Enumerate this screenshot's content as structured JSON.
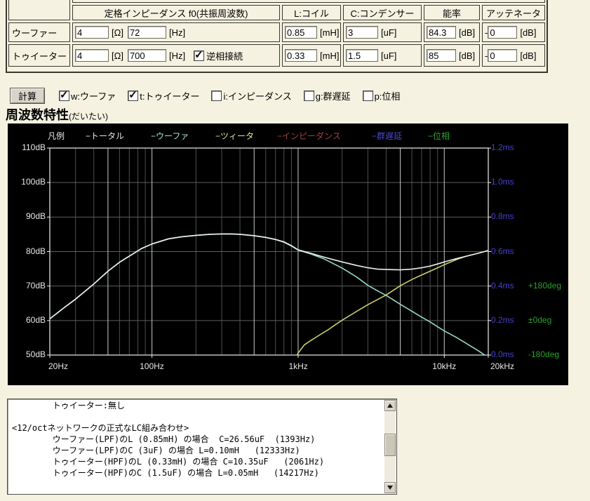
{
  "speaker_table": {
    "headers": {
      "spec": "定格インピーダンス f0(共振周波数)",
      "coil": "L:コイル",
      "cap": "C:コンデンサー",
      "efficiency": "能率",
      "attenuator": "アッテネータ"
    },
    "units": {
      "impedance": "[Ω]",
      "f0": "[Hz]",
      "coil": "[mH]",
      "cap": "[uF]",
      "db": "[dB]"
    },
    "rows": {
      "0": {
        "label": "ウーファー",
        "impedance": "4",
        "f0": "72",
        "coil": "0.85",
        "cap": "3",
        "efficiency": "84.3",
        "att_prefix": "-",
        "attenuator": "0"
      },
      "1": {
        "label": "トゥイーター",
        "impedance": "4",
        "f0": "700",
        "reverse_label": "逆相接続",
        "reverse_checked": true,
        "coil": "0.33",
        "cap": "1.5",
        "efficiency": "85",
        "att_prefix": "-",
        "attenuator": "0"
      }
    }
  },
  "controls": {
    "calc_button": "計算",
    "checkboxes": [
      {
        "id": "woofer",
        "label": "w:ウーファ",
        "checked": true
      },
      {
        "id": "tweeter",
        "label": "t:トゥイーター",
        "checked": true
      },
      {
        "id": "impedance",
        "label": "i:インピーダンス",
        "checked": false
      },
      {
        "id": "group-delay",
        "label": "g:群遅延",
        "checked": false
      },
      {
        "id": "phase",
        "label": "p:位相",
        "checked": false
      }
    ]
  },
  "heading": {
    "title": "周波数特性",
    "subtitle": "(だいたい)"
  },
  "chart_data": {
    "type": "line",
    "title": "周波数特性(だいたい)",
    "x_axis": {
      "scale": "log",
      "min": 20,
      "max": 20000,
      "ticks": [
        {
          "f": 20,
          "label": "20Hz",
          "align": "left"
        },
        {
          "f": 100,
          "label": "100Hz"
        },
        {
          "f": 1000,
          "label": "1kHz"
        },
        {
          "f": 10000,
          "label": "10kHz"
        },
        {
          "f": 20000,
          "label": "20kHz",
          "dx": 20
        }
      ]
    },
    "y_axis": {
      "min": 50,
      "max": 110,
      "ticks": [
        {
          "db": 110,
          "label": "110dB",
          "ms": "1.2ms"
        },
        {
          "db": 100,
          "label": "100dB",
          "ms": "1.0ms"
        },
        {
          "db": 90,
          "label": "90dB",
          "ms": "0.8ms"
        },
        {
          "db": 80,
          "label": "80dB",
          "ms": "0.6ms"
        },
        {
          "db": 70,
          "label": "70dB",
          "ms": "0.4ms",
          "deg": "+180deg"
        },
        {
          "db": 60,
          "label": "60dB",
          "ms": "0.2ms",
          "deg": "±0deg"
        },
        {
          "db": 50,
          "label": "50dB",
          "ms": "0.0ms",
          "deg": "-180deg"
        }
      ]
    },
    "grid": {
      "v_minor": [
        30,
        40,
        60,
        70,
        80,
        90,
        200,
        300,
        400,
        600,
        700,
        800,
        900,
        2000,
        3000,
        4000,
        6000,
        7000,
        8000,
        9000
      ],
      "v_major": [
        50,
        100,
        500,
        1000,
        5000,
        10000
      ],
      "h_lines": [
        100,
        90,
        80,
        70,
        60
      ],
      "minor_color": "#4f4f4f",
      "major_color": "#c8c8c8",
      "h_color": "#5e5e5e",
      "frame_color": "#efefef"
    },
    "legend": {
      "title": "凡例",
      "items": [
        {
          "label": "トータル",
          "color": "#e8e8e8"
        },
        {
          "label": "ウーファ",
          "color": "#a6e2d2"
        },
        {
          "label": "ツィータ",
          "color": "#e2e29e"
        },
        {
          "label": "インピーダンス",
          "color": "#a04444"
        },
        {
          "label": "群遅延",
          "color": "#4b4bd2"
        },
        {
          "label": "位相",
          "color": "#2fa32f"
        }
      ]
    },
    "series": [
      {
        "name": "ウーファ",
        "color": "#96d8c8",
        "points": [
          [
            20,
            60.5
          ],
          [
            25,
            63.7
          ],
          [
            30,
            66.2
          ],
          [
            40,
            70.6
          ],
          [
            50,
            74.3
          ],
          [
            60,
            76.9
          ],
          [
            72,
            79.0
          ],
          [
            85,
            80.9
          ],
          [
            100,
            82.2
          ],
          [
            130,
            83.7
          ],
          [
            160,
            84.3
          ],
          [
            200,
            84.7
          ],
          [
            250,
            85.0
          ],
          [
            300,
            85.1
          ],
          [
            350,
            85.1
          ],
          [
            400,
            85.0
          ],
          [
            500,
            84.6
          ],
          [
            600,
            84.1
          ],
          [
            700,
            83.5
          ],
          [
            800,
            82.7
          ],
          [
            900,
            81.6
          ],
          [
            1000,
            80.4
          ],
          [
            1200,
            79.4
          ],
          [
            1500,
            77.9
          ],
          [
            1800,
            76.2
          ],
          [
            2000,
            75.2
          ],
          [
            2500,
            72.7
          ],
          [
            3000,
            70.2
          ],
          [
            3500,
            68.6
          ],
          [
            4000,
            67.3
          ],
          [
            5000,
            64.7
          ],
          [
            6000,
            62.7
          ],
          [
            7000,
            61.0
          ],
          [
            8000,
            59.6
          ],
          [
            9000,
            58.2
          ],
          [
            10000,
            57.0
          ],
          [
            12000,
            55.2
          ],
          [
            14000,
            53.5
          ],
          [
            17000,
            51.3
          ],
          [
            20000,
            49.3
          ]
        ]
      },
      {
        "name": "ツィータ",
        "color": "#cdd06a",
        "points": [
          [
            940,
            48.5
          ],
          [
            1000,
            50.6
          ],
          [
            1100,
            52.9
          ],
          [
            1200,
            54.0
          ],
          [
            1400,
            55.8
          ],
          [
            1600,
            57.3
          ],
          [
            1800,
            58.8
          ],
          [
            2000,
            60.1
          ],
          [
            2500,
            62.6
          ],
          [
            3000,
            64.6
          ],
          [
            3500,
            66.1
          ],
          [
            4000,
            67.4
          ],
          [
            5000,
            70.1
          ],
          [
            6000,
            71.9
          ],
          [
            7000,
            73.2
          ],
          [
            8000,
            74.3
          ],
          [
            9000,
            75.3
          ],
          [
            10000,
            76.2
          ],
          [
            12000,
            77.6
          ],
          [
            14000,
            78.6
          ],
          [
            17000,
            79.5
          ],
          [
            20000,
            80.3
          ]
        ]
      },
      {
        "name": "トータル",
        "color": "#e9f2e9",
        "points": [
          [
            20,
            60.5
          ],
          [
            25,
            63.7
          ],
          [
            30,
            66.2
          ],
          [
            40,
            70.6
          ],
          [
            50,
            74.3
          ],
          [
            60,
            76.9
          ],
          [
            72,
            79.0
          ],
          [
            85,
            80.9
          ],
          [
            100,
            82.2
          ],
          [
            130,
            83.7
          ],
          [
            160,
            84.3
          ],
          [
            200,
            84.7
          ],
          [
            250,
            85.0
          ],
          [
            300,
            85.1
          ],
          [
            350,
            85.1
          ],
          [
            400,
            85.0
          ],
          [
            500,
            84.6
          ],
          [
            600,
            84.1
          ],
          [
            700,
            83.5
          ],
          [
            800,
            82.8
          ],
          [
            900,
            81.7
          ],
          [
            1000,
            80.5
          ],
          [
            1200,
            79.6
          ],
          [
            1500,
            78.4
          ],
          [
            2000,
            77.0
          ],
          [
            2500,
            76.0
          ],
          [
            3000,
            75.3
          ],
          [
            3500,
            74.9
          ],
          [
            4000,
            74.8
          ],
          [
            5000,
            74.7
          ],
          [
            6000,
            74.9
          ],
          [
            7000,
            75.3
          ],
          [
            8000,
            75.8
          ],
          [
            9000,
            76.4
          ],
          [
            10000,
            77.0
          ],
          [
            12000,
            77.9
          ],
          [
            14000,
            78.6
          ],
          [
            17000,
            79.5
          ],
          [
            20000,
            80.3
          ]
        ]
      }
    ]
  },
  "output_box": {
    "lines": [
      "        トゥイーター:無し",
      "",
      "<12/octネットワークの正式なLC組み合わせ>",
      "        ウーファー(LPF)のL (0.85mH) の場合  C=26.56uF  (1393Hz)",
      "        ウーファー(LPF)のC (3uF) の場合 L=0.10mH   (12333Hz)",
      "        トゥイーター(HPF)のL (0.33mH) の場合 C=10.35uF   (2061Hz)",
      "        トゥイーター(HPF)のC (1.5uF) の場合 L=0.05mH   (14217Hz)"
    ]
  }
}
